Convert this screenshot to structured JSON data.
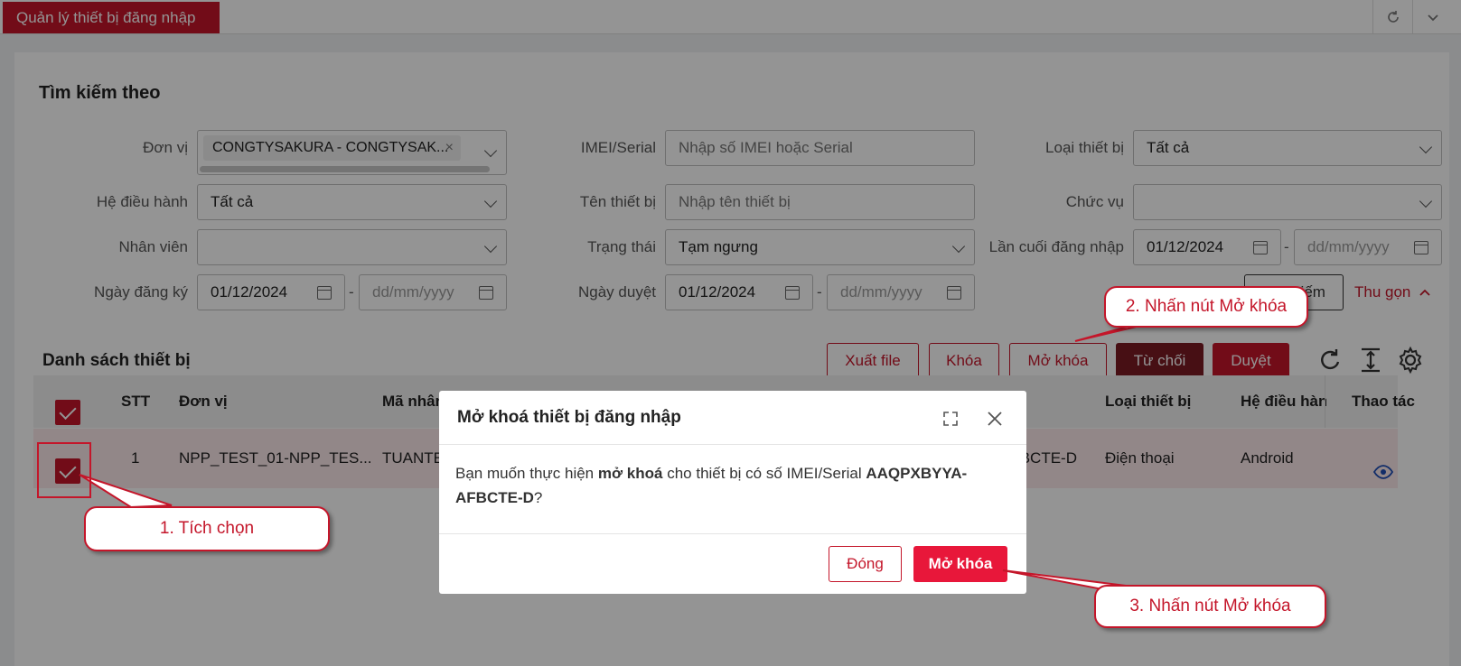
{
  "topbar": {
    "tab_label": "Quản lý thiết bị đăng nhập"
  },
  "search": {
    "title": "Tìm kiếm theo",
    "don_vi_label": "Đơn vị",
    "don_vi_tag": "CONGTYSAKURA - CONGTYSAK...",
    "imei_label": "IMEI/Serial",
    "imei_placeholder": "Nhập số IMEI hoặc Serial",
    "loai_tb_label": "Loại thiết bị",
    "loai_tb_value": "Tất cả",
    "hdh_label": "Hệ điều hành",
    "hdh_value": "Tất cả",
    "ten_tb_label": "Tên thiết bị",
    "ten_tb_placeholder": "Nhập tên thiết bị",
    "chuc_vu_label": "Chức vụ",
    "chuc_vu_value": "",
    "nhan_vien_label": "Nhân viên",
    "nhan_vien_value": "",
    "trang_thai_label": "Trạng thái",
    "trang_thai_value": "Tạm ngưng",
    "lan_cuoi_label": "Lần cuối đăng nhập",
    "lan_cuoi_from": "01/12/2024",
    "lan_cuoi_to_ph": "dd/mm/yyyy",
    "ngay_dk_label": "Ngày đăng ký",
    "ngay_dk_from": "01/12/2024",
    "ngay_dk_to_ph": "dd/mm/yyyy",
    "ngay_duyet_label": "Ngày duyệt",
    "ngay_duyet_from": "01/12/2024",
    "ngay_duyet_to_ph": "dd/mm/yyyy",
    "dash": "-",
    "search_button": "Tìm kiếm",
    "collapse_link": "Thu gọn"
  },
  "list": {
    "title": "Danh sách thiết bị",
    "buttons": {
      "export": "Xuất file",
      "lock": "Khóa",
      "unlock": "Mở khóa",
      "reject": "Từ chối",
      "approve": "Duyệt"
    },
    "columns": [
      "STT",
      "Đơn vị",
      "Mã nhân viên",
      "Loại thiết bị",
      "Hệ điều hành",
      "Thao tác"
    ],
    "rows": [
      {
        "stt": "1",
        "don_vi": "NPP_TEST_01-NPP_TES...",
        "ma_nv": "TUANTE",
        "imei": "AAQPXBYYA-AFBCTE-D",
        "loai": "Điện thoại",
        "hdh": "Android"
      }
    ]
  },
  "modal": {
    "title": "Mở khoá thiết bị đăng nhập",
    "body_prefix": "Bạn muốn thực hiện ",
    "body_action": "mở khoá",
    "body_mid": " cho thiết bị có số IMEI/Serial ",
    "body_imei": "AAQPXBYYA-AFBCTE-D",
    "body_suffix": "?",
    "close_button": "Đóng",
    "confirm_button": "Mở khóa"
  },
  "callouts": {
    "step1": "1. Tích chọn",
    "step2": "2. Nhấn nút Mở khóa",
    "step3": "3. Nhấn nút Mở khóa"
  },
  "colors": {
    "brand": "#c4162a",
    "dark_red": "#7a1a24",
    "row_highlight": "#fbe8ea"
  }
}
